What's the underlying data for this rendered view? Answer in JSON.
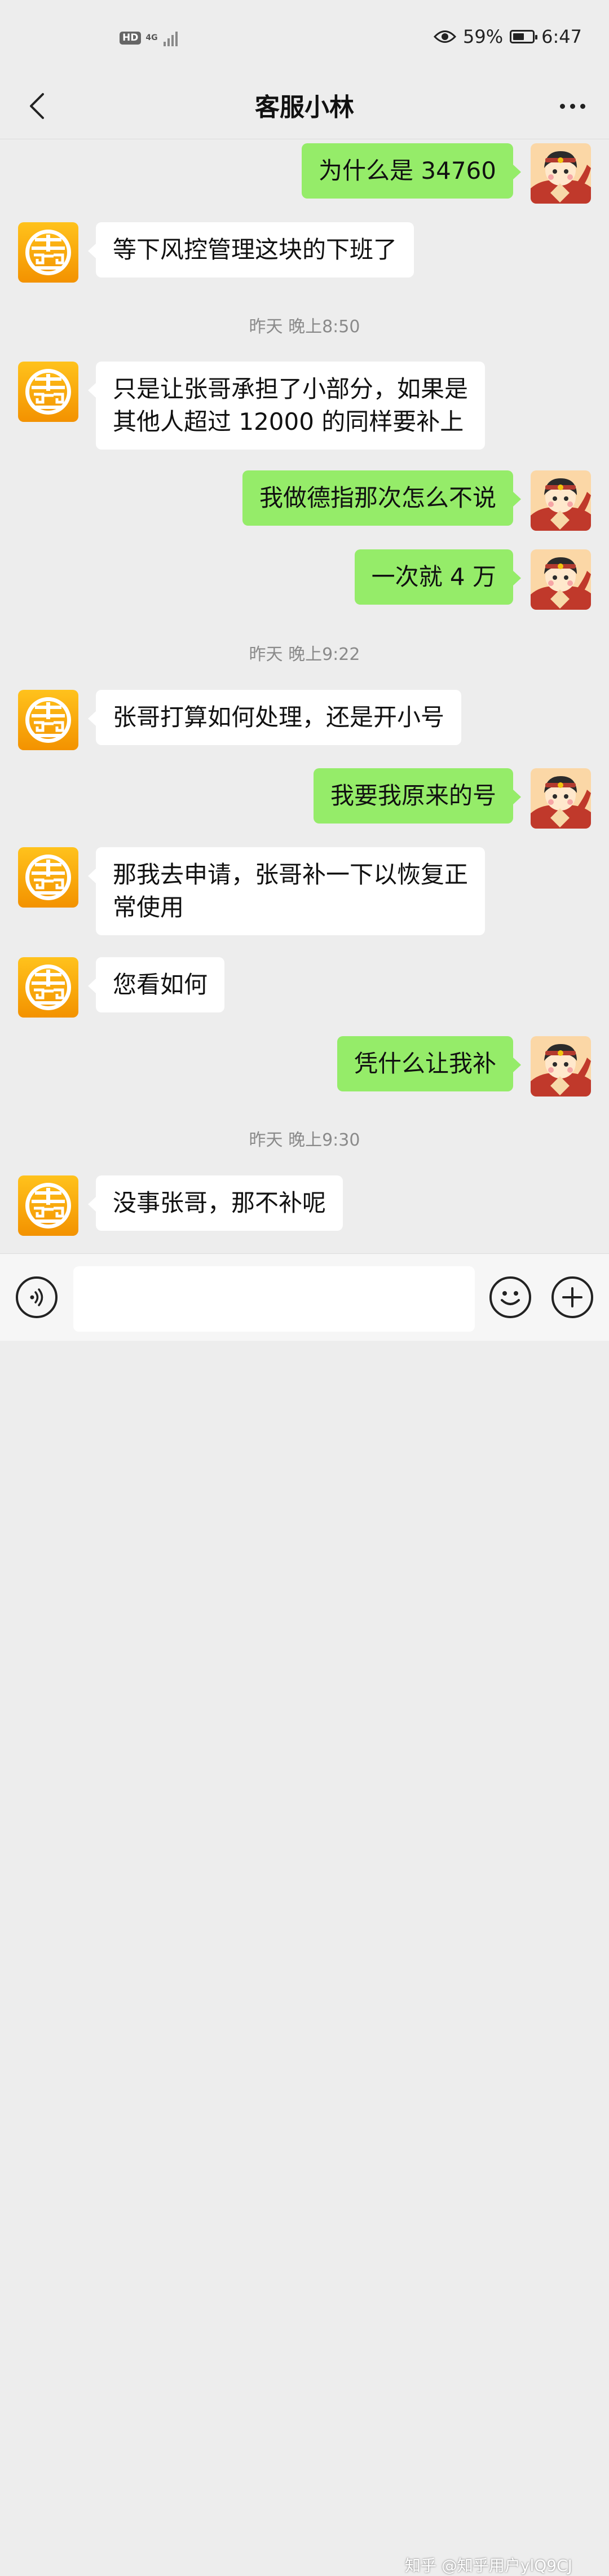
{
  "status_bar": {
    "hd": "HD",
    "network": "4G",
    "battery_percent": "59%",
    "battery_level": 0.59,
    "time": "6:47"
  },
  "header": {
    "title": "客服小林"
  },
  "messages": [
    {
      "type": "out",
      "text": "为什么是 34760"
    },
    {
      "type": "in",
      "text": "等下风控管理这块的下班了"
    },
    {
      "type": "time",
      "text": "昨天 晚上8:50"
    },
    {
      "type": "in",
      "lines": [
        "只是让张哥承担了小部分，如果是",
        "其他人超过 12000 的同样要补上"
      ]
    },
    {
      "type": "out",
      "text": "我做德指那次怎么不说"
    },
    {
      "type": "out",
      "text": "一次就 4 万"
    },
    {
      "type": "time",
      "text": "昨天 晚上9:22"
    },
    {
      "type": "in",
      "text": "张哥打算如何处理，还是开小号"
    },
    {
      "type": "out",
      "text": "我要我原来的号"
    },
    {
      "type": "in",
      "lines": [
        "那我去申请，张哥补一下以恢复正",
        "常使用"
      ]
    },
    {
      "type": "in",
      "text": "您看如何"
    },
    {
      "type": "out",
      "text": "凭什么让我补"
    },
    {
      "type": "time",
      "text": "昨天 晚上9:30"
    },
    {
      "type": "in",
      "text": "没事张哥，那不补呢"
    }
  ],
  "icons": {
    "back": "chevron-left-icon",
    "more": "more-dots-icon",
    "voice": "voice-icon",
    "emoji": "emoji-icon",
    "plus": "plus-icon",
    "agent_avatar": "agent-avatar-logo",
    "user_avatar": "user-avatar-cartoon"
  },
  "colors": {
    "background": "#ededed",
    "out_bubble": "#95ec69",
    "in_bubble": "#ffffff",
    "agent_avatar": "#f5a300"
  },
  "input": {
    "value": "",
    "placeholder": ""
  },
  "watermark": "知乎 @知乎用户ylQ9CJ"
}
